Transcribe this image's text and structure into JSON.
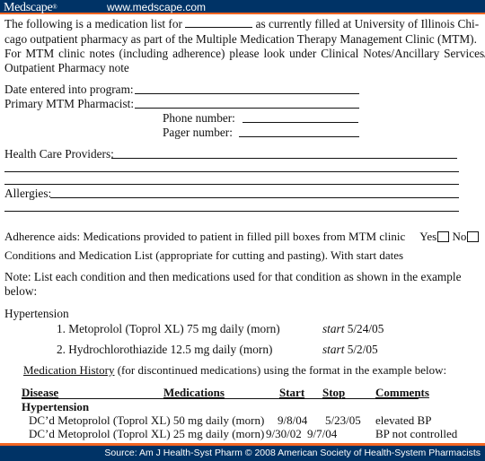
{
  "header": {
    "logo": "Medscape",
    "logo_mark": "®",
    "url": "www.medscape.com"
  },
  "intro": {
    "line1_before_blank": "The following is a medication list for",
    "line1_after_blank": "as currently filled at University of Illinois Chi-",
    "line2": "cago outpatient pharmacy as part of the Multiple Medication Therapy Management Clinic (MTM).",
    "line3": "For MTM clinic notes (including adherence) please look under Clinical Notes/Ancillary Services/",
    "line4": "Outpatient Pharmacy note"
  },
  "fields": {
    "date_entered_label": "Date entered into program:",
    "primary_pharmacist_label": "Primary MTM Pharmacist:",
    "phone_label": "Phone number:",
    "pager_label": "Pager number:",
    "providers_label": "Health Care Providers:",
    "allergies_label": "Allergies:"
  },
  "adherence": {
    "text": "Adherence aids: Medications provided to patient in filled pill boxes from MTM clinic",
    "yes_label": "Yes",
    "no_label": "No",
    "yes_checked": false,
    "no_checked": false
  },
  "conditions_heading": "Conditions and Medication List (appropriate for cutting and pasting). With start dates",
  "note": {
    "line1": "Note: List each condition and then medications used for that condition as shown in the example",
    "line2": "below:"
  },
  "example": {
    "condition": "Hypertension",
    "medications": [
      {
        "text": "1. Metoprolol (Toprol XL) 75 mg daily (morn)",
        "start_label": "start",
        "start_date": "5/24/05"
      },
      {
        "text": "2. Hydrochlorothiazide 12.5 mg daily (morn)",
        "start_label": "start",
        "start_date": "5/2/05"
      }
    ]
  },
  "history": {
    "title": "Medication History",
    "description": "(for discontinued medications) using the format in the example below:",
    "columns": [
      "Disease",
      "Medications",
      "Start",
      "Stop",
      "Comments"
    ],
    "group": "Hypertension",
    "rows": [
      {
        "medication": "DC’d Metoprolol (Toprol XL) 50 mg daily (morn)",
        "start": "9/8/04",
        "stop": "5/23/05",
        "comment": "elevated BP"
      },
      {
        "medication": "DC’d Metoprolol (Toprol XL) 25 mg daily (morn)",
        "start": "9/30/02",
        "stop": "9/7/04",
        "comment": "BP not controlled"
      }
    ]
  },
  "footer": {
    "source": "Source: Am J Health-Syst Pharm © 2008 American Society of Health-System Pharmacists"
  },
  "colors": {
    "banner": "#003366",
    "accent": "#f26522"
  }
}
